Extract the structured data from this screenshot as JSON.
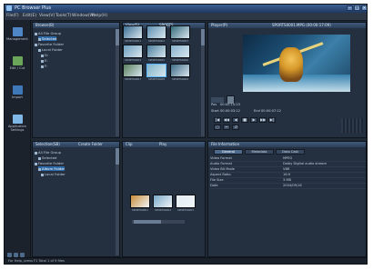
{
  "window": {
    "title": "PC Browser Plus"
  },
  "menu": [
    "File(F)",
    "Edit(E)",
    "View(V)",
    "Tools(T)",
    "Window(W)",
    "Help(H)"
  ],
  "sidebar": [
    {
      "label": "Management",
      "color": "#4f86c6"
    },
    {
      "label": "Edit / Cut",
      "color": "#6aa55a"
    },
    {
      "label": "Import",
      "color": "#3f78b8"
    },
    {
      "label": "Application Settings",
      "color": "#7fb7e6"
    }
  ],
  "panes": {
    "library": {
      "title": "Browse(B)",
      "rows": [
        {
          "label": "All File Group",
          "selected": false
        },
        {
          "label": "Selected",
          "selected": true
        },
        {
          "label": "Favorite Folder",
          "selected": false
        },
        {
          "label": "Local Folder",
          "selected": false
        },
        {
          "label": "D:",
          "selected": false
        },
        {
          "label": "E:",
          "selected": false
        },
        {
          "label": "F:",
          "selected": false
        }
      ]
    },
    "browser": {
      "title": "View(S)",
      "title2": "SPORTS"
    },
    "player": {
      "title": "Player(P)",
      "filename": "SPORTS0001.MPG (00:00:17:09)"
    },
    "selection": {
      "title": "Selection(SB)",
      "subtitle": "Create Folder",
      "rows": [
        {
          "label": "All File Group",
          "selected": false
        },
        {
          "label": "Selected",
          "selected": false
        },
        {
          "label": "Favorite Folder",
          "selected": false
        },
        {
          "label": "Album Folder",
          "selected": true
        },
        {
          "label": "Local Folder",
          "selected": false
        }
      ]
    },
    "clips": {
      "title": "Clip",
      "title2": "Play"
    },
    "info": {
      "title": "File Information",
      "tabs": [
        "General",
        "Metadata",
        "Data Cast"
      ],
      "rows": [
        {
          "key": "Video Format",
          "value": "MPEG"
        },
        {
          "key": "Audio Format",
          "value": "Dolby Digital audio stream"
        },
        {
          "key": "Video Bit Mode",
          "value": "VBR"
        },
        {
          "key": "Aspect Ratio",
          "value": "16:9"
        },
        {
          "key": "File Size",
          "value": "3 MB"
        },
        {
          "key": "Date",
          "value": "2004/09/16"
        }
      ]
    }
  },
  "thumbnails": [
    "SPORTS0001",
    "SPORTS0002",
    "SPORTS0003",
    "SPORTS0004",
    "SPORTS0005",
    "SPORTS0006",
    "SPORTS0007",
    "SPORTS0008",
    "SPORTS0009"
  ],
  "thumb_colors": [
    "#3b6f93",
    "#5d8fb2",
    "#356b7c",
    "#6e9fc0",
    "#4b7e9d",
    "#87b3cf",
    "#5a7f5e",
    "#7eb4c8",
    "#3d6a85"
  ],
  "clip_thumbnails": [
    "SPORTS0001",
    "SPORTS0002",
    "SPORTS0003"
  ],
  "clip_colors": [
    "#c98c3a",
    "#7aa9c9",
    "#e4eef4"
  ],
  "player_controls": {
    "start_label": "Start",
    "start_time": "00:00:03:12",
    "end_label": "End",
    "end_time": "00:00:07:12",
    "position_label": "Pos",
    "position_time": "00:00:10:23"
  },
  "status": {
    "text": "For Help, press F1   Total 1 of 9 files"
  }
}
